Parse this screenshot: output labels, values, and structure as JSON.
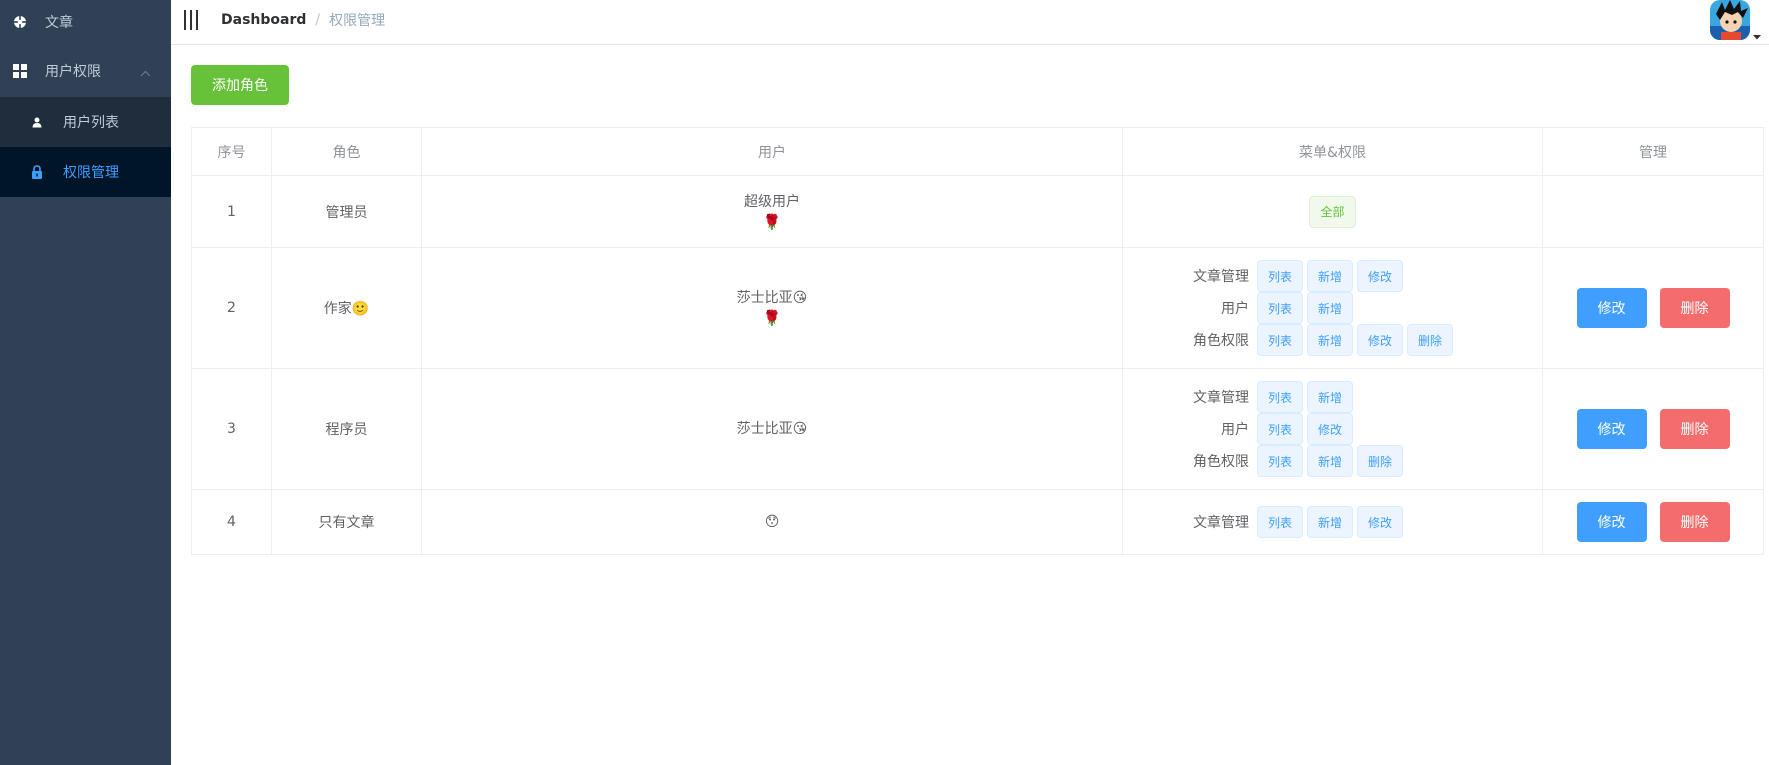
{
  "sidebar": {
    "items": [
      {
        "label": "文章",
        "icon": "gear-icon"
      },
      {
        "label": "用户权限",
        "icon": "grid-icon",
        "expanded": true,
        "children": [
          {
            "label": "用户列表",
            "icon": "user-icon",
            "active": false
          },
          {
            "label": "权限管理",
            "icon": "lock-icon",
            "active": true
          }
        ]
      }
    ],
    "colors": {
      "background": "#304156",
      "submenu": "#1f2d3d",
      "active_bg": "#001528",
      "active_text": "#409eff"
    }
  },
  "navbar": {
    "breadcrumb": {
      "home": "Dashboard",
      "separator": "/",
      "current": "权限管理"
    }
  },
  "main": {
    "add_role_label": "添加角色",
    "table": {
      "headers": [
        "序号",
        "角色",
        "用户",
        "菜单&权限",
        "管理"
      ],
      "rows": [
        {
          "index": "1",
          "role": "管理员",
          "user_name": "超级用户",
          "user_emoji": "🌹",
          "all_label": "全部",
          "perms": []
        },
        {
          "index": "2",
          "role": "作家🙂",
          "user_name": "莎士比亚😘",
          "user_emoji": "🌹",
          "perms": [
            {
              "menu": "文章管理",
              "actions": [
                "列表",
                "新增",
                "修改"
              ]
            },
            {
              "menu": "用户",
              "actions": [
                "列表",
                "新增"
              ]
            },
            {
              "menu": "角色权限",
              "actions": [
                "列表",
                "新增",
                "修改",
                "删除"
              ]
            }
          ],
          "edit_label": "修改",
          "delete_label": "删除"
        },
        {
          "index": "3",
          "role": "程序员",
          "user_name": "莎士比亚😘",
          "user_emoji": "",
          "perms": [
            {
              "menu": "文章管理",
              "actions": [
                "列表",
                "新增"
              ]
            },
            {
              "menu": "用户",
              "actions": [
                "列表",
                "修改"
              ]
            },
            {
              "menu": "角色权限",
              "actions": [
                "列表",
                "新增",
                "删除"
              ]
            }
          ],
          "edit_label": "修改",
          "delete_label": "删除"
        },
        {
          "index": "4",
          "role": "只有文章",
          "user_name": "😯",
          "user_emoji": "",
          "perms": [
            {
              "menu": "文章管理",
              "actions": [
                "列表",
                "新增",
                "修改"
              ]
            }
          ],
          "edit_label": "修改",
          "delete_label": "删除"
        }
      ]
    }
  },
  "colors": {
    "add": "#67c23a",
    "primary": "#409eff",
    "danger": "#f56c6c"
  }
}
